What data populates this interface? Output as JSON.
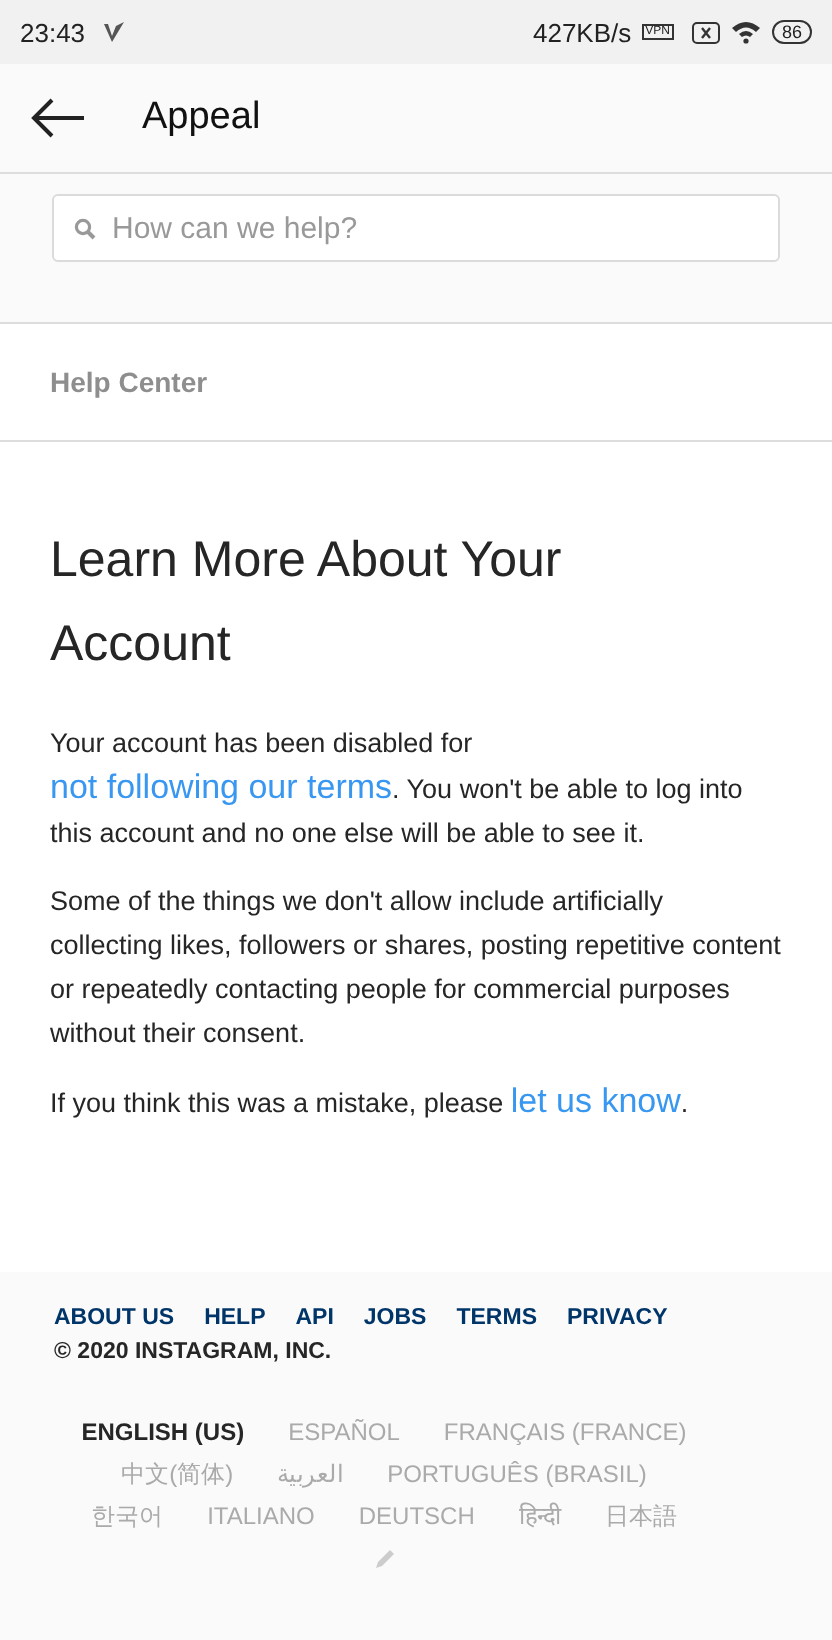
{
  "status_bar": {
    "time": "23:43",
    "speed": "427KB/s",
    "vpn": "VPN",
    "battery": "86"
  },
  "header": {
    "title": "Appeal"
  },
  "search": {
    "placeholder": "How can we help?"
  },
  "section": {
    "label": "Help Center"
  },
  "article": {
    "title": "Learn More About Your Account",
    "paragraphs": [
      [
        {
          "kind": "text",
          "text": "Your account has been disabled for "
        },
        {
          "kind": "link",
          "text": "not following our terms"
        },
        {
          "kind": "text",
          "text": ". You won't be able to log into this account and no one else will be able to see it."
        }
      ],
      [
        {
          "kind": "text",
          "text": "Some of the things we don't allow include artificially collecting likes, followers or shares, posting repetitive content or repeatedly contacting people for commercial purposes without their consent."
        }
      ],
      [
        {
          "kind": "text",
          "text": "If you think this was a mistake, please "
        },
        {
          "kind": "link",
          "text": "let us know"
        },
        {
          "kind": "text",
          "text": "."
        }
      ]
    ]
  },
  "footer": {
    "links": [
      "ABOUT US",
      "HELP",
      "API",
      "JOBS",
      "TERMS",
      "PRIVACY"
    ],
    "copyright": "© 2020 INSTAGRAM, INC.",
    "languages": [
      {
        "label": "ENGLISH (US)",
        "selected": true
      },
      {
        "label": "ESPAÑOL",
        "selected": false
      },
      {
        "label": "FRANÇAIS (FRANCE)",
        "selected": false
      },
      {
        "label": "中文(简体)",
        "selected": false
      },
      {
        "label": "العربية",
        "selected": false
      },
      {
        "label": "PORTUGUÊS (BRASIL)",
        "selected": false
      },
      {
        "label": "한국어",
        "selected": false
      },
      {
        "label": "ITALIANO",
        "selected": false
      },
      {
        "label": "DEUTSCH",
        "selected": false
      },
      {
        "label": "हिन्दी",
        "selected": false
      },
      {
        "label": "日本語",
        "selected": false
      }
    ]
  }
}
